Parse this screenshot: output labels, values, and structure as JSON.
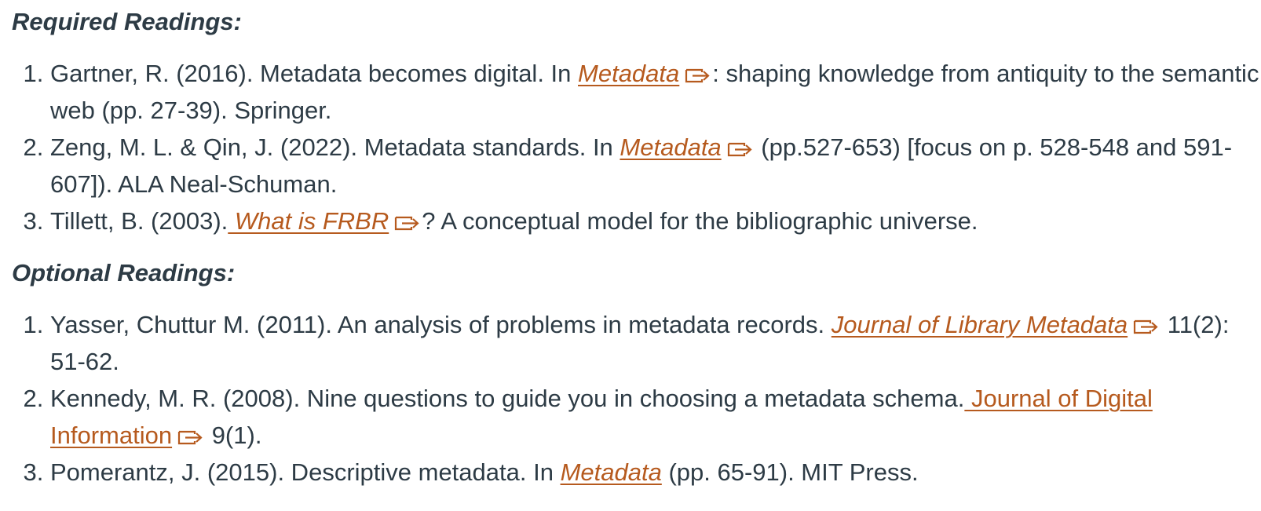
{
  "required": {
    "heading": "Required Readings:",
    "items": [
      {
        "before": "Gartner, R. (2016). Metadata becomes digital. In ",
        "link": "Metadata",
        "after": ": shaping knowledge from antiquity to the semantic web (pp. 27-39). Springer."
      },
      {
        "before": "Zeng, M. L. & Qin, J. (2022). Metadata standards. In ",
        "link": "Metadata",
        "after": " (pp.527-653) [focus on p. 528-548 and 591-607]). ALA Neal-Schuman."
      },
      {
        "before": "Tillett, B. (2003).",
        "link": " What is FRBR",
        "after": "? A conceptual model for the bibliographic universe."
      }
    ]
  },
  "optional": {
    "heading": "Optional Readings:",
    "items": [
      {
        "before": "Yasser, Chuttur M. (2011). An analysis of problems in metadata records. ",
        "link": "Journal of Library Metadata",
        "after": " 11(2): 51-62."
      },
      {
        "before": "Kennedy, M. R. (2008). Nine questions to guide you in choosing a metadata schema.",
        "link": " Journal of Digital Information",
        "after": " 9(1)."
      },
      {
        "before": "Pomerantz, J. (2015). Descriptive metadata. In ",
        "link": "Metadata",
        "after": " (pp. 65-91). MIT Press."
      }
    ]
  },
  "icons": {
    "external_link": "external-link-icon"
  },
  "colors": {
    "text": "#2d3b45",
    "link": "#b65a1e",
    "background": "#ffffff"
  }
}
